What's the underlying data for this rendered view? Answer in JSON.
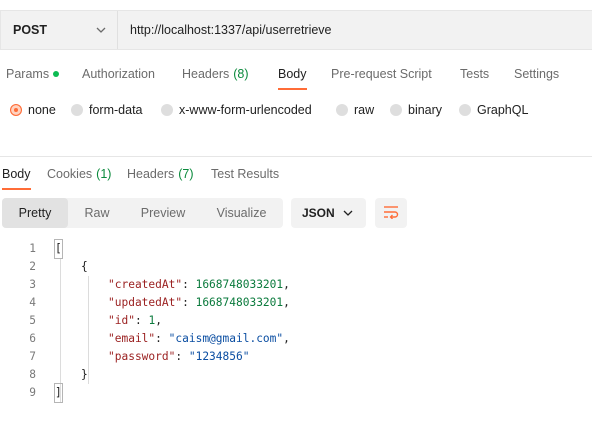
{
  "request": {
    "method": "POST",
    "url": "http://localhost:1337/api/userretrieve"
  },
  "request_tabs": [
    {
      "label": "Params",
      "active": false,
      "dot": true
    },
    {
      "label": "Authorization",
      "active": false
    },
    {
      "label": "Headers",
      "count": "(8)",
      "active": false
    },
    {
      "label": "Body",
      "active": true
    },
    {
      "label": "Pre-request Script",
      "active": false
    },
    {
      "label": "Tests",
      "active": false
    },
    {
      "label": "Settings",
      "active": false
    }
  ],
  "body_types": [
    {
      "label": "none",
      "selected": true
    },
    {
      "label": "form-data",
      "selected": false
    },
    {
      "label": "x-www-form-urlencoded",
      "selected": false
    },
    {
      "label": "raw",
      "selected": false
    },
    {
      "label": "binary",
      "selected": false
    },
    {
      "label": "GraphQL",
      "selected": false
    }
  ],
  "response_tabs": [
    {
      "label": "Body",
      "active": true
    },
    {
      "label": "Cookies",
      "count": "(1)",
      "active": false
    },
    {
      "label": "Headers",
      "count": "(7)",
      "active": false
    },
    {
      "label": "Test Results",
      "active": false
    }
  ],
  "view_modes": [
    {
      "label": "Pretty",
      "active": true
    },
    {
      "label": "Raw",
      "active": false
    },
    {
      "label": "Preview",
      "active": false
    },
    {
      "label": "Visualize",
      "active": false
    }
  ],
  "format": "JSON",
  "code_lines": [
    {
      "n": "1",
      "text": "["
    },
    {
      "n": "2",
      "text": "{"
    },
    {
      "n": "3",
      "key": "\"createdAt\"",
      "value": "1668748033201",
      "vtype": "num",
      "comma": ","
    },
    {
      "n": "4",
      "key": "\"updatedAt\"",
      "value": "1668748033201",
      "vtype": "num",
      "comma": ","
    },
    {
      "n": "5",
      "key": "\"id\"",
      "value": "1",
      "vtype": "num",
      "comma": ","
    },
    {
      "n": "6",
      "key": "\"email\"",
      "value": "\"caism@gmail.com\"",
      "vtype": "str",
      "comma": ","
    },
    {
      "n": "7",
      "key": "\"password\"",
      "value": "\"1234856\"",
      "vtype": "str",
      "comma": ""
    },
    {
      "n": "8",
      "text": "}"
    },
    {
      "n": "9",
      "text": "]"
    }
  ],
  "colors": {
    "accent": "#ff6c37",
    "json_key": "#9a1f1f",
    "json_number": "#0a7a3c",
    "json_string": "#0b4ea2"
  }
}
